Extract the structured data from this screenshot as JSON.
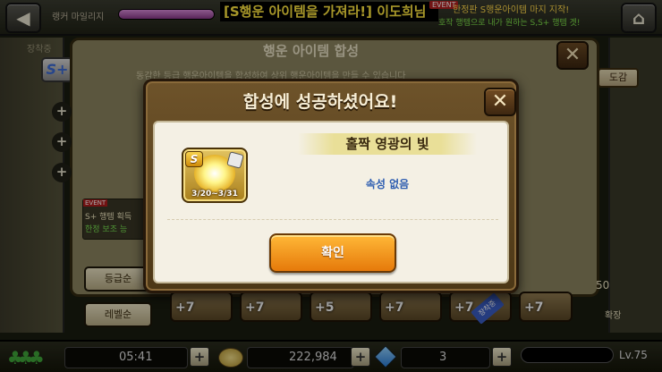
{
  "topbar": {
    "mileage_label": "랭커 마일리지",
    "banner": "[S행운 아이템을 가져라!] 이도희님",
    "event_tag": "EVENT",
    "event_line1": "한정판 S행운아이템 마지 지작!",
    "event_line2": "호작 행템으로 내가 원하는 S,S+ 행템 겟!",
    "mileage_fraction": 1.0
  },
  "background": {
    "left_tab_label": "장착중",
    "s_plus_label": "S+",
    "dialog_title": "행운 아이템 합성",
    "dialog_desc": "동감한 등급 행운아이템을 합성하여 상위 행운아이템을 만들 수 있습니다",
    "dogam_label": "도감",
    "event_box_tag": "EVENT",
    "event_box_line1": "S+ 행템 획득",
    "event_box_line2": "한정 보조 능",
    "sort_grade_label": "등급순",
    "sort_level_label": "레벨순",
    "side_number": "50",
    "expand_label": "확장",
    "slots": [
      "+7",
      "+7",
      "+5",
      "+7",
      "+7",
      "+7"
    ],
    "equipped_badge": "장착중",
    "plus_symbol": "+"
  },
  "statusbar": {
    "time": "05:41",
    "coins": "222,984",
    "gems": "3",
    "level": "Lv.75",
    "add_symbol": "+"
  },
  "modal": {
    "title": "합성에 성공하셨어요!",
    "close_symbol": "✕",
    "item": {
      "grade": "S",
      "period": "3/20~3/31",
      "name": "홀짝 영광의 빛",
      "attribute": "속성 없음"
    },
    "confirm_label": "확인"
  }
}
